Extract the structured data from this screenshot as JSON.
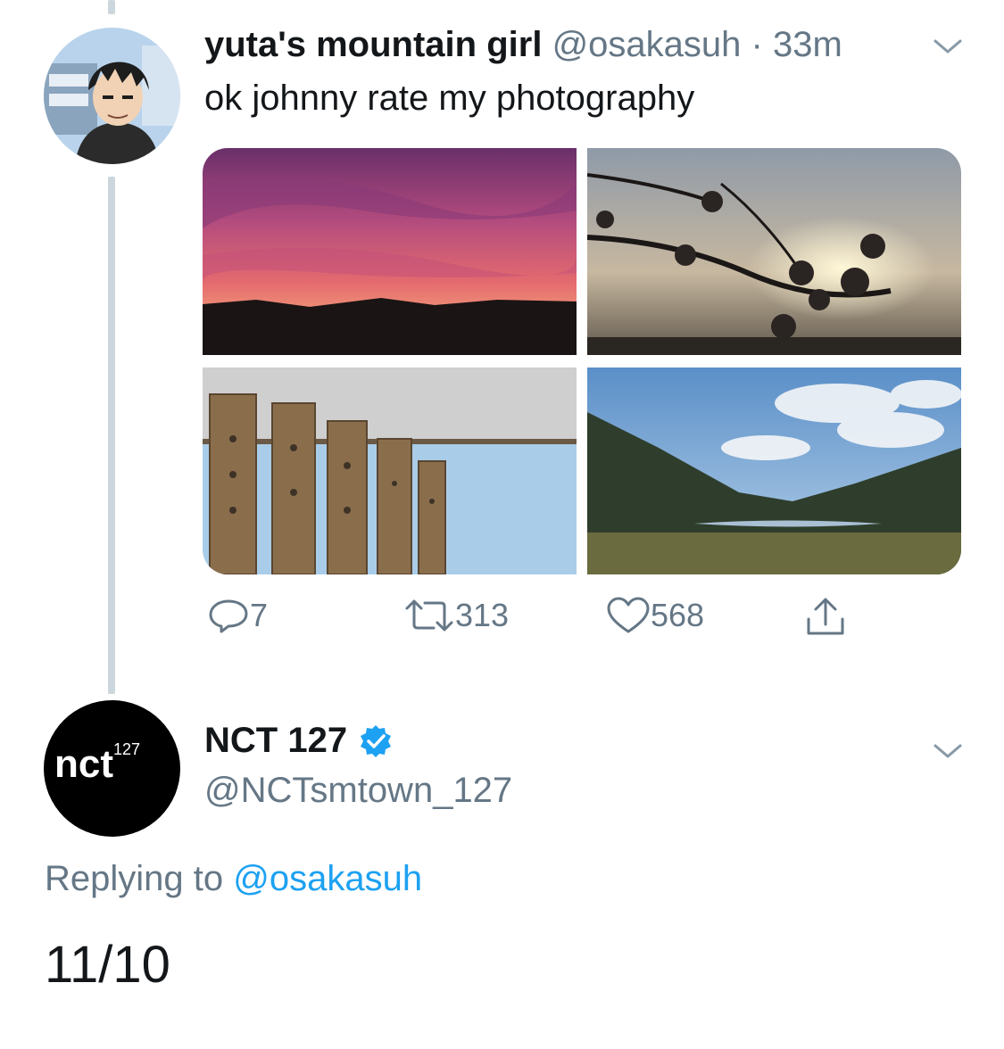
{
  "tweet": {
    "display_name": "yuta's mountain girl",
    "handle": "@osakasuh",
    "separator": "·",
    "time": "33m",
    "text": "ok johnny rate my photography",
    "avatar_icon": "anime-character-avatar",
    "photos": [
      {
        "name": "sunset-photo",
        "subject": "purple and pink sunset sky over dark hills"
      },
      {
        "name": "cherry-blossom-photo",
        "subject": "silhouetted blossom branch against sun"
      },
      {
        "name": "wind-chime-photo",
        "subject": "bamboo wind chimes against sky"
      },
      {
        "name": "mountain-lake-photo",
        "subject": "mountain valley with lake and clouds"
      }
    ],
    "actions": {
      "replies": "7",
      "retweets": "313",
      "likes": "568"
    }
  },
  "reply": {
    "display_name": "NCT 127",
    "verified": true,
    "handle": "@NCTsmtown_127",
    "avatar_logo": {
      "main": "nct",
      "sup": "127"
    },
    "replying_prefix": "Replying to",
    "replying_handle": "@osakasuh",
    "text": "11/10"
  },
  "colors": {
    "link_blue": "#1da1f2",
    "muted": "#657786",
    "thread_line": "#ccd6dd",
    "verified_blue": "#1da1f2"
  }
}
